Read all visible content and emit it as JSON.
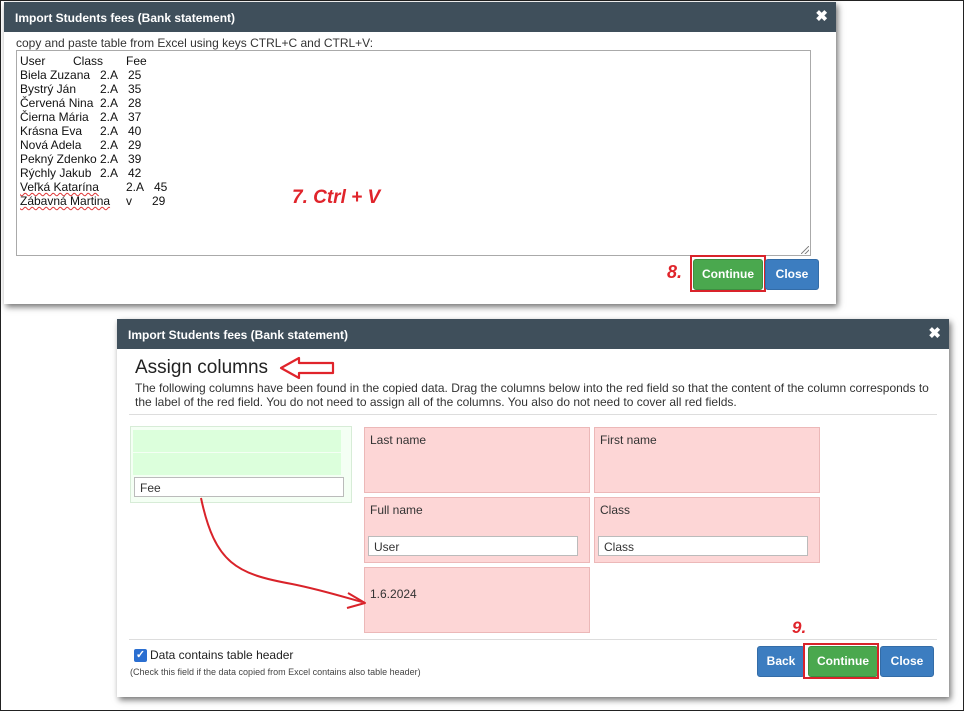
{
  "dialog1": {
    "title": "Import Students fees (Bank statement)",
    "close_glyph": "✖",
    "instructions": "copy and paste table from Excel using keys CTRL+C and CTRL+V:",
    "rows": [
      [
        "User",
        "Class",
        "Fee"
      ],
      [
        "Biela Zuzana",
        "2.A",
        "25"
      ],
      [
        "Bystrý Ján",
        "2.A",
        "35"
      ],
      [
        "Červená Nina",
        "2.A",
        "28"
      ],
      [
        "Čierna Mária",
        "2.A",
        "37"
      ],
      [
        "Krásna Eva",
        "2.A",
        "40"
      ],
      [
        "Nová Adela",
        "2.A",
        "29"
      ],
      [
        "Pekný Zdenko",
        "2.A",
        "39"
      ],
      [
        "Rýchly Jakub",
        "2.A",
        "42"
      ],
      [
        "Veľká Katarína",
        "2.A",
        "45"
      ],
      [
        "Zábavná Martina",
        "v",
        "29"
      ]
    ],
    "annotation_paste": "7. Ctrl + V",
    "annotation_step": "8.",
    "continue_label": "Continue",
    "close_label": "Close"
  },
  "dialog2": {
    "title": "Import Students fees (Bank statement)",
    "close_glyph": "✖",
    "heading": "Assign columns",
    "description": "The following columns have been found in the copied data. Drag the columns below into the red field so that the content of the column corresponds to the label of the red field. You do not need to assign all of the columns. You also do not need to cover all red fields.",
    "unassigned_column": "Fee",
    "targets": {
      "last_name": {
        "label": "Last name"
      },
      "first_name": {
        "label": "First name"
      },
      "full_name": {
        "label": "Full name",
        "assigned": "User"
      },
      "class": {
        "label": "Class",
        "assigned": "Class"
      },
      "date": {
        "label": "1.6.2024"
      }
    },
    "checkbox_label": "Data contains table header",
    "checkbox_checked": true,
    "checkbox_hint": "(Check this field if the data copied from Excel contains also table header)",
    "annotation_step": "9.",
    "back_label": "Back",
    "continue_label": "Continue",
    "close_label": "Close"
  },
  "colors": {
    "titlebar": "#3f4f5b",
    "continue_green": "#4aa84e",
    "close_blue": "#3c7dc0",
    "target_red": "#fdd6d6",
    "source_green": "#dcffdc",
    "annotation_red": "#e0242b"
  }
}
